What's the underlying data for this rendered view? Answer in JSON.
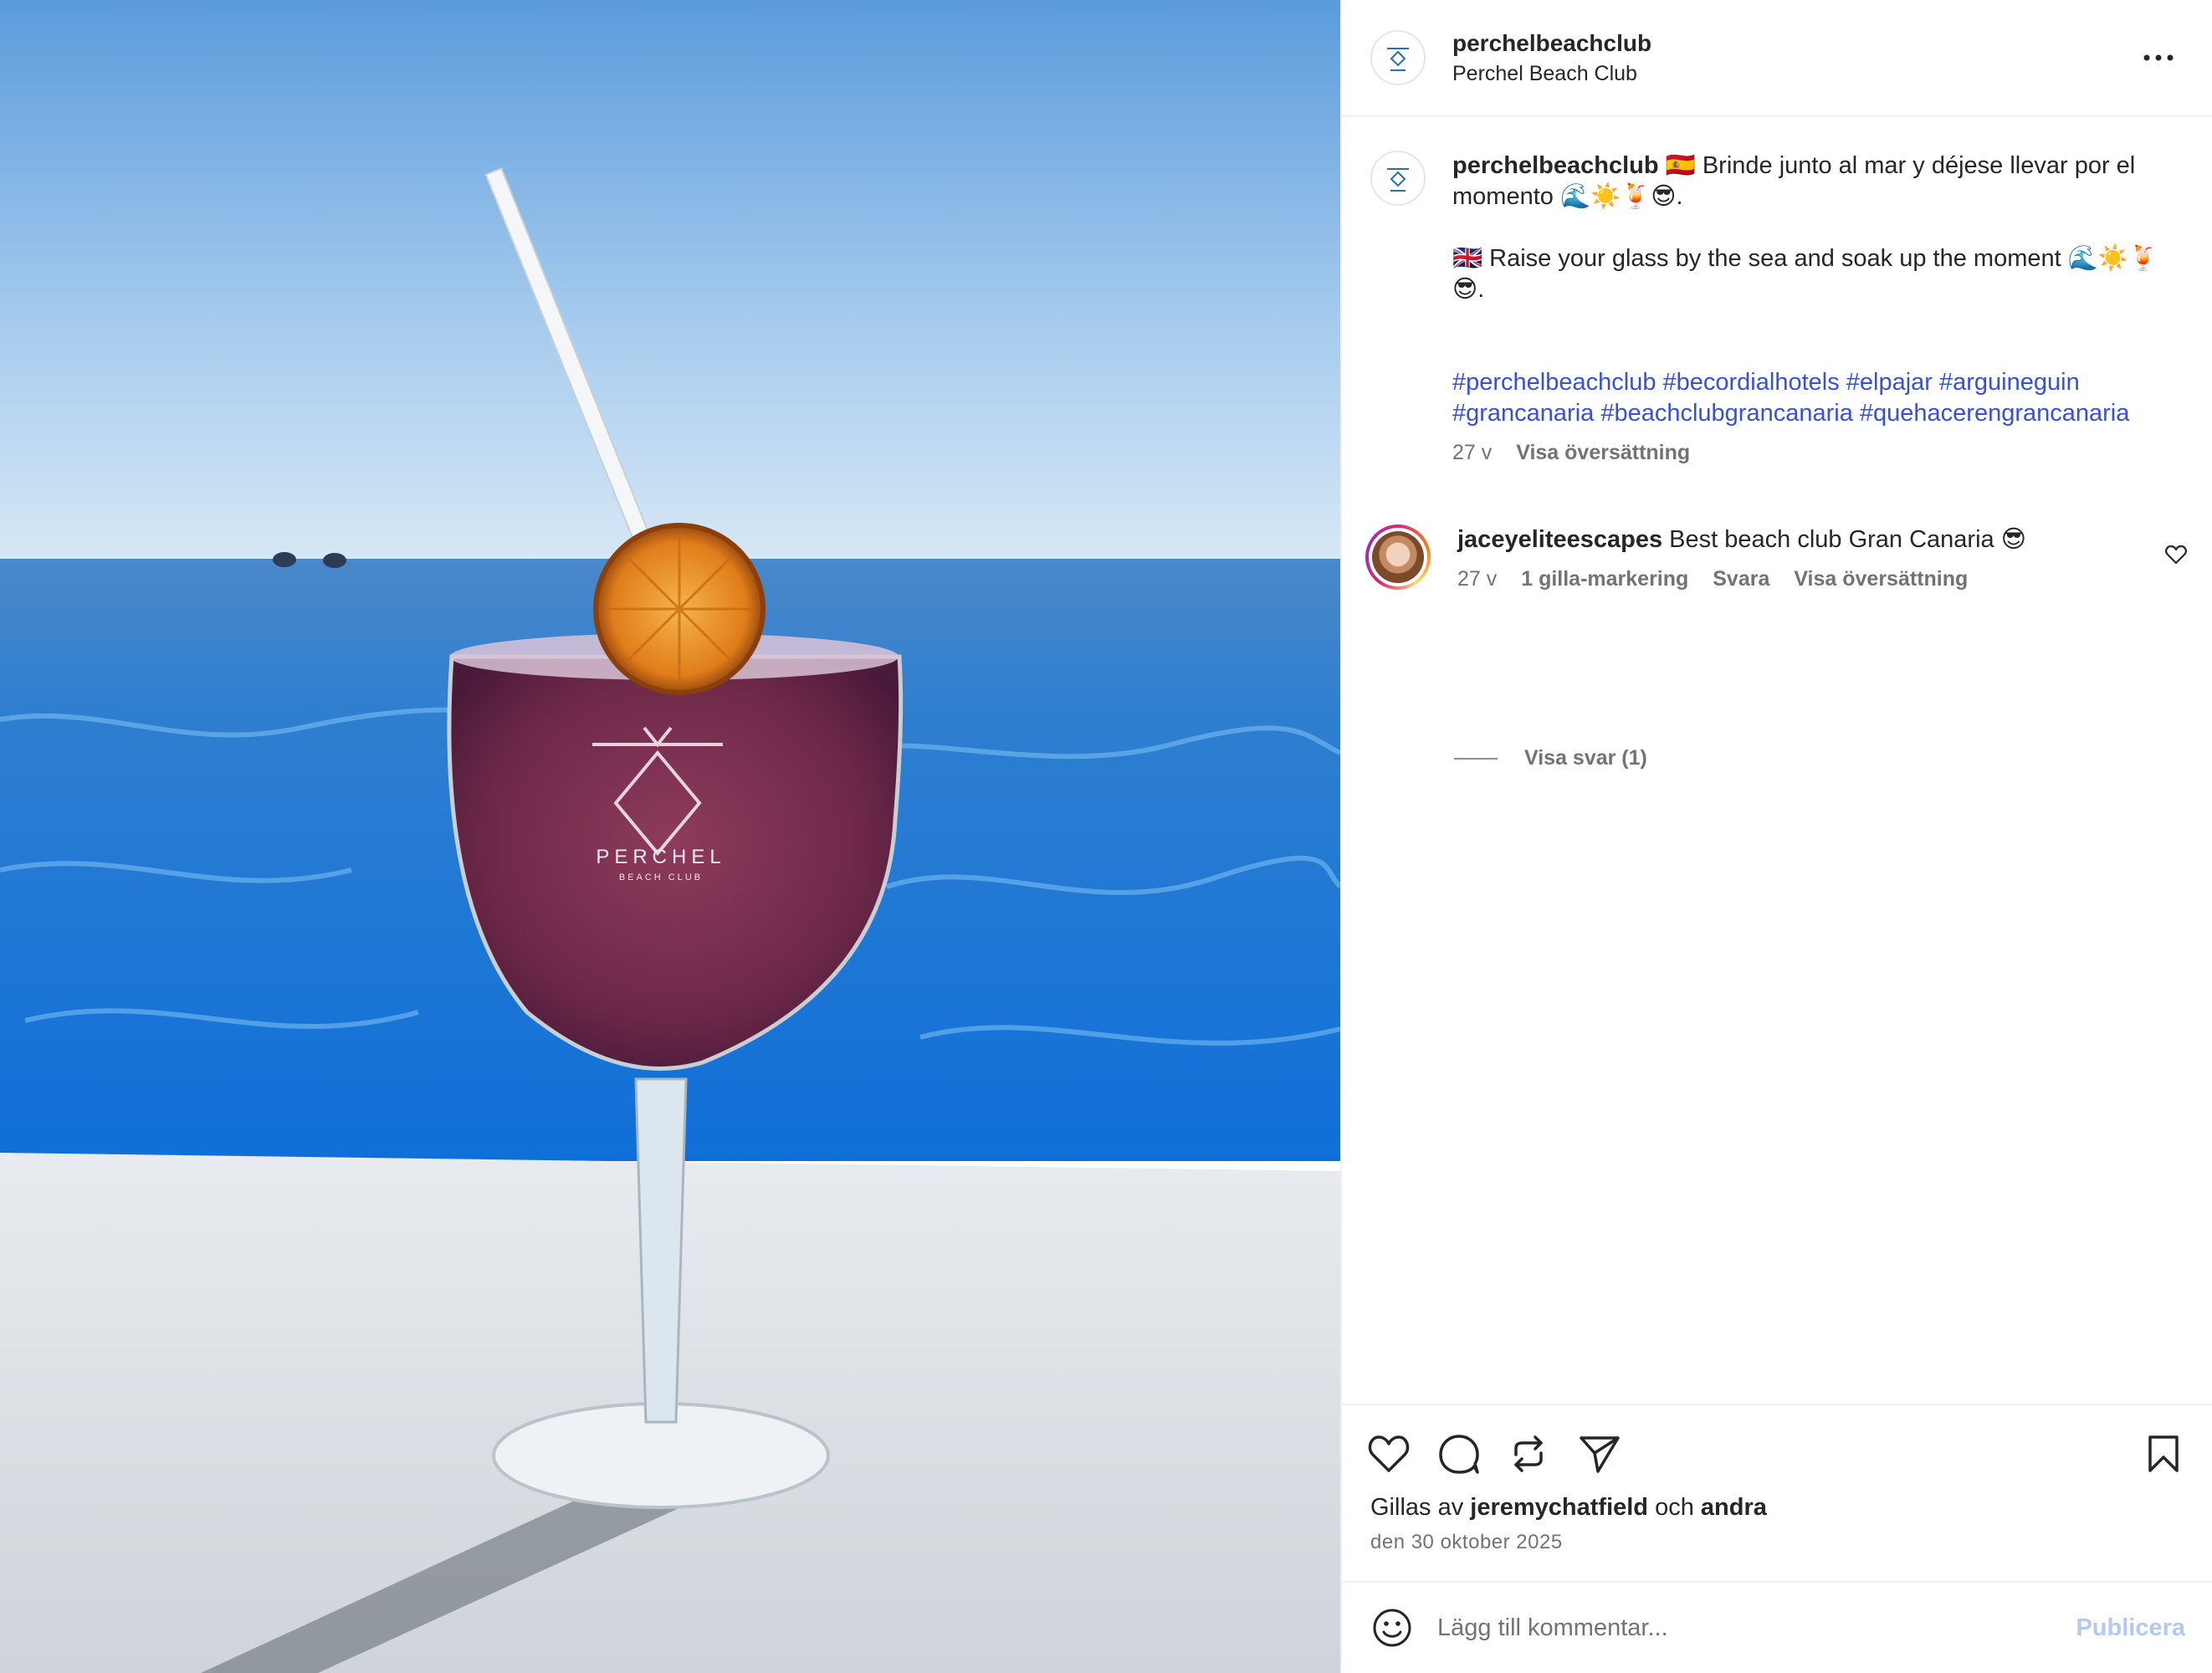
{
  "header": {
    "username": "perchelbeachclub",
    "subtitle": "Perchel Beach Club",
    "more_icon": "more-horizontal-icon"
  },
  "photo": {
    "glass_brand": "PERCHEL",
    "glass_sub": "BEACH CLUB"
  },
  "caption": {
    "username": "perchelbeachclub",
    "line_es": "🇪🇸 Brinde junto al mar y déjese llevar por el momento 🌊☀️🍹😎.",
    "line_en": "🇬🇧 Raise your glass by the sea and soak up the moment 🌊☀️🍹😎.",
    "hashtags": "#perchelbeachclub #becordialhotels #elpajar #arguineguin #grancanaria #beachclubgrancanaria #quehacerengrancanaria",
    "time": "27 v",
    "translate": "Visa översättning"
  },
  "comment": {
    "username": "jaceyeliteescapes",
    "text": "Best beach club Gran Canaria 😎",
    "time": "27 v",
    "likes": "1 gilla-markering",
    "reply": "Svara",
    "translate": "Visa översättning",
    "view_replies": "Visa svar (1)"
  },
  "actions": {
    "icons": [
      "heart-icon",
      "comment-icon",
      "repost-icon",
      "share-icon",
      "bookmark-icon"
    ],
    "liked_by_prefix": "Gillas av",
    "liked_by_user": "jeremychatfield",
    "liked_by_joiner": "och",
    "liked_by_others": "andra",
    "date": "den 30 oktober 2025"
  },
  "add_comment": {
    "placeholder": "Lägg till kommentar...",
    "publish": "Publicera"
  },
  "colors": {
    "link": "#3650d6",
    "publish_disabled": "#b3c8f2",
    "muted": "#737373"
  }
}
